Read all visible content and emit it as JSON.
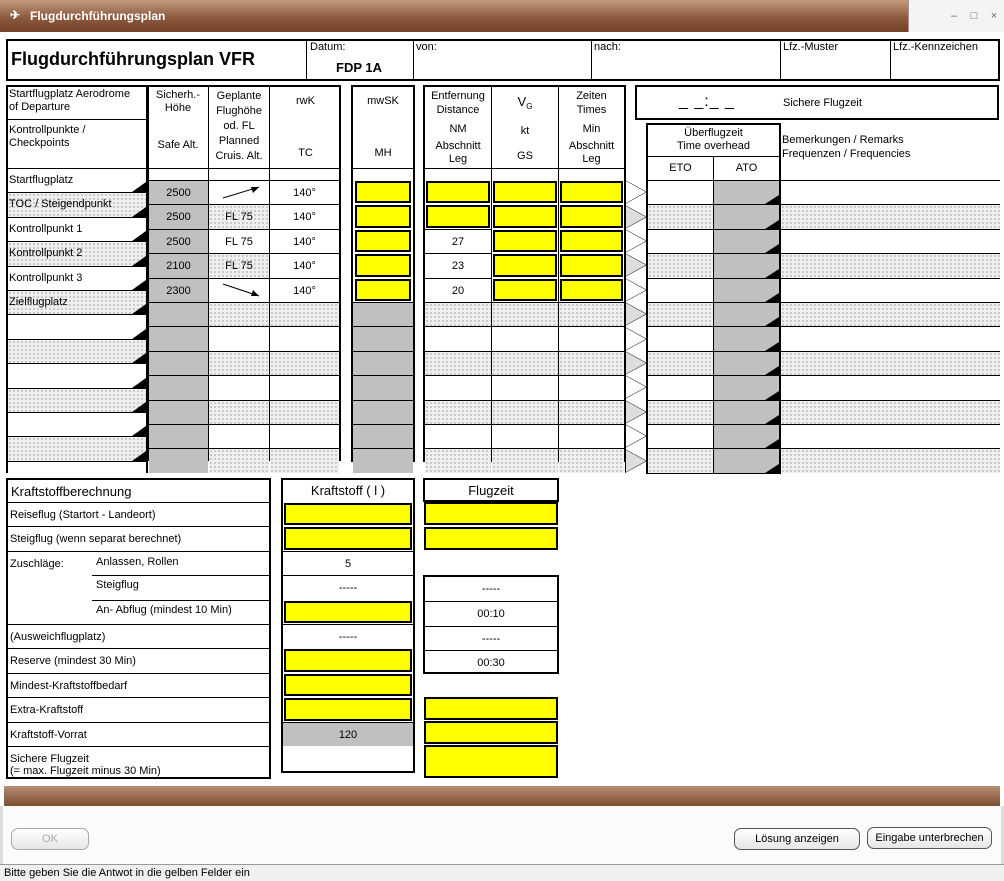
{
  "window": {
    "title": "Flugdurchführungsplan",
    "controls": [
      "–",
      "□",
      "×"
    ]
  },
  "header": {
    "title": "Flugdurchführungsplan VFR",
    "datum_label": "Datum:",
    "datum_value": "FDP 1A",
    "von_label": "von:",
    "nach_label": "nach:",
    "muster_label": "Lfz.-Muster",
    "kennzeichen_label": "Lfz.-Kennzeichen"
  },
  "sichere_flugzeit": {
    "placeholder": "_ _:_ _",
    "label": "Sichere Flugzeit"
  },
  "table_headers": {
    "start_line1": "Startflugplatz   Aerodrome",
    "start_line2": "of Departure",
    "kontroll_line1": "Kontrollpunkte /",
    "kontroll_line2": "Checkpoints",
    "sicher_1": "Sicherh.-",
    "sicher_2": "Höhe",
    "sicher_3": "Safe Alt.",
    "geplant_1": "Geplante",
    "geplant_2": "Flughöhe",
    "geplant_3": "od. FL",
    "geplant_4": "Planned",
    "geplant_5": "Cruis. Alt.",
    "rwk": "rwK",
    "tc": "TC",
    "mwsk": "mwSK",
    "mh": "MH",
    "entf_1": "Entfernung",
    "entf_2": "Distance",
    "entf_3": "NM",
    "entf_4": "Abschnitt",
    "entf_5": "Leg",
    "vg": "V",
    "vg_sub": "G",
    "kt": "kt",
    "gs": "GS",
    "zeit_1": "Zeiten",
    "zeit_2": "Times",
    "zeit_3": "Min",
    "zeit_4": "Abschnitt",
    "zeit_5": "Leg",
    "ueber_1": "Überflugzeit",
    "ueber_2": "Time overhead",
    "eto": "ETO",
    "ato": "ATO",
    "bem_1": "Bemerkungen / Remarks",
    "bem_2": "Frequenzen / Frequencies"
  },
  "waypoints": [
    "Startflugplatz",
    "TOC / Steigendpunkt",
    "Kontrollpunkt 1",
    "Kontrollpunkt 2",
    "Kontrollpunkt 3",
    "Zielflugplatz",
    "",
    "",
    "",
    "",
    "",
    "",
    ""
  ],
  "legs": [
    {
      "safe_alt": "2500",
      "cruise": "arrow-up",
      "tc": "140°",
      "dist": ""
    },
    {
      "safe_alt": "2500",
      "cruise": "FL 75",
      "tc": "140°",
      "dist": ""
    },
    {
      "safe_alt": "2500",
      "cruise": "FL 75",
      "tc": "140°",
      "dist": "27"
    },
    {
      "safe_alt": "2100",
      "cruise": "FL 75",
      "tc": "140°",
      "dist": "23"
    },
    {
      "safe_alt": "2300",
      "cruise": "arrow-down",
      "tc": "140°",
      "dist": "20"
    }
  ],
  "fuel": {
    "title": "Kraftstoffberechnung",
    "kraftstoff_header": "Kraftstoff ( l )",
    "flugzeit_header": "Flugzeit",
    "rows": [
      {
        "label": "Reiseflug (Startort - Landeort)",
        "fuel": "",
        "time": ""
      },
      {
        "label": "Steigflug (wenn separat berechnet)",
        "fuel": "",
        "time": ""
      },
      {
        "label": "Zuschläge:",
        "sub": "Anlassen, Rollen",
        "fuel": "5",
        "time": ""
      },
      {
        "label": "",
        "sub": "Steigflug",
        "fuel": "-----",
        "time": "-----"
      },
      {
        "label": "",
        "sub": "An- Abflug (mindest 10 Min)",
        "fuel": "",
        "time": "00:10"
      },
      {
        "label": "(Ausweichflugplatz)",
        "fuel": "-----",
        "time": "-----"
      },
      {
        "label": "Reserve (mindest 30 Min)",
        "fuel": "",
        "time": "00:30"
      },
      {
        "label": "Mindest-Kraftstoffbedarf",
        "fuel": "",
        "time": ""
      },
      {
        "label": "Extra-Kraftstoff",
        "fuel": "",
        "time": ""
      },
      {
        "label": "Kraftstoff-Vorrat",
        "fuel": "120",
        "time": ""
      },
      {
        "label": "Sichere Flugzeit",
        "label2": "(= max. Flugzeit minus 30 Min)",
        "fuel": "",
        "time": ""
      }
    ]
  },
  "buttons": {
    "ok": "OK",
    "loesung": "Lösung anzeigen",
    "abbrechen": "Eingabe unterbrechen"
  },
  "status": "Bitte geben Sie die Antwot in die gelben Felder ein",
  "colors": {
    "input_yellow": "#ffff00",
    "readonly_gray": "#c0c0c0",
    "titlebar_brown": "#8b5a3f"
  }
}
